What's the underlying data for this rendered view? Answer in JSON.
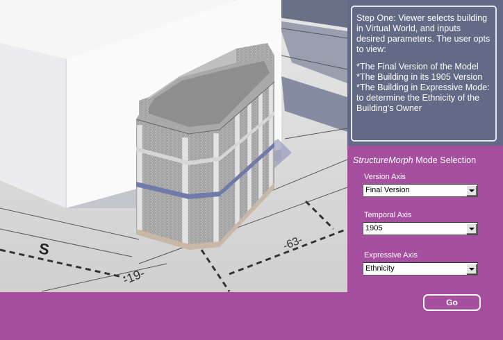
{
  "info": {
    "step_text": "Step One:  Viewer selects building in Virtual World, and inputs desired parameters. The user opts to view:",
    "options": [
      "*The Final Version of the Model",
      "*The Building in its 1905 Version",
      "*The Building in Expressive Mode: to determine the Ethnicity of the Building's Owner"
    ]
  },
  "panel": {
    "title_italic": "StructureMorph",
    "title_rest": " Mode Selection",
    "version": {
      "label": "Version Axis",
      "value": "Final Version"
    },
    "temporal": {
      "label": "Temporal Axis",
      "value": "1905"
    },
    "expressive": {
      "label": "Expressive Axis",
      "value": "Ethnicity"
    }
  },
  "go_label": "Go",
  "map_labels": [
    "S",
    "-19-",
    "-63-"
  ],
  "colors": {
    "background": "#a64f9e",
    "info_panel": "#626a86",
    "accent_text": "#ffffff"
  }
}
